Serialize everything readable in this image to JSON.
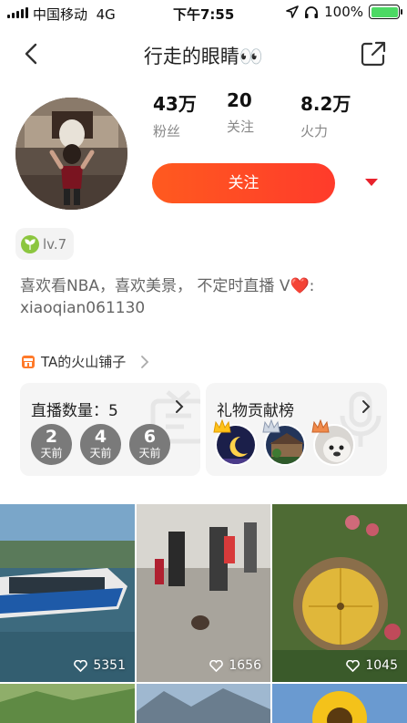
{
  "status_bar": {
    "carrier": "中国移动",
    "network": "4G",
    "time": "下午7:55",
    "battery": "100%",
    "battery_level": 1.0
  },
  "nav": {
    "title": "行走的眼睛👀"
  },
  "profile": {
    "stats": [
      {
        "value": "43万",
        "label": "粉丝"
      },
      {
        "value": "20",
        "label": "关注"
      },
      {
        "value": "8.2万",
        "label": "火力"
      }
    ],
    "follow_label": "关注",
    "level": "lv.7",
    "bio": "喜欢看NBA，喜欢美景， 不定时直播 V❤️: xiaoqian061130"
  },
  "shop": {
    "label": "TA的火山铺子"
  },
  "live_card": {
    "title": "直播数量：5",
    "days": [
      {
        "n": "2",
        "t": "天前"
      },
      {
        "n": "4",
        "t": "天前"
      },
      {
        "n": "6",
        "t": "天前"
      }
    ]
  },
  "gift_card": {
    "title": "礼物贡献榜"
  },
  "videos": [
    {
      "likes": "5351"
    },
    {
      "likes": "1656"
    },
    {
      "likes": "1045"
    }
  ],
  "colors": {
    "accent": "#ff4526",
    "dropdown": "#e8222c",
    "battery": "#4cd964"
  }
}
